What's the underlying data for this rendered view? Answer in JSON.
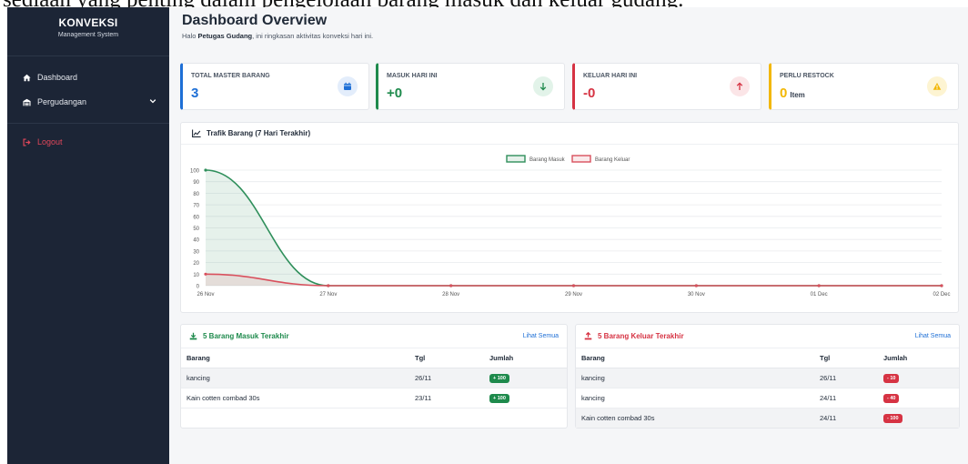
{
  "caption": "sediaan yang penting dalam pengelolaan barang masuk dan keluar gudang.",
  "sidebar": {
    "brand_title": "KONVEKSI",
    "brand_subtitle": "Management System",
    "items": [
      {
        "label": "Dashboard",
        "icon": "home-icon"
      },
      {
        "label": "Pergudangan",
        "icon": "warehouse-icon",
        "expandable": true
      }
    ],
    "logout_label": "Logout"
  },
  "header": {
    "title": "Dashboard Overview",
    "subtitle_prefix": "Halo ",
    "subtitle_user": "Petugas Gudang",
    "subtitle_suffix": ", ini ringkasan aktivitas konveksi hari ini."
  },
  "stats": [
    {
      "label": "TOTAL MASTER BARANG",
      "value": "3",
      "unit": "",
      "color": "#1e6fd6",
      "icon": "calendar-icon"
    },
    {
      "label": "MASUK HARI INI",
      "value": "+0",
      "unit": "",
      "color": "#1e8a4c",
      "icon": "arrow-down-icon"
    },
    {
      "label": "KELUAR HARI INI",
      "value": "-0",
      "unit": "",
      "color": "#d63343",
      "icon": "arrow-up-icon"
    },
    {
      "label": "PERLU RESTOCK",
      "value": "0",
      "unit": "Item",
      "color": "#f2b705",
      "icon": "warning-icon"
    }
  ],
  "chart_data": {
    "type": "line",
    "title": "Trafik Barang (7 Hari Terakhir)",
    "categories": [
      "26 Nov",
      "27 Nov",
      "28 Nov",
      "29 Nov",
      "30 Nov",
      "01 Dec",
      "02 Dec"
    ],
    "series": [
      {
        "name": "Barang Masuk",
        "values": [
          100,
          0,
          0,
          0,
          0,
          0,
          0
        ],
        "color": "#2f8f5b"
      },
      {
        "name": "Barang Keluar",
        "values": [
          10,
          0,
          0,
          0,
          0,
          0,
          0
        ],
        "color": "#d9505d"
      }
    ],
    "ylim": [
      0,
      100
    ],
    "yticks": [
      "0",
      "10",
      "20",
      "30",
      "40",
      "50",
      "60",
      "70",
      "80",
      "90",
      "100"
    ],
    "legend_position": "top-center",
    "grid": true
  },
  "masuk": {
    "title": "5 Barang Masuk Terakhir",
    "link": "Lihat Semua",
    "columns": [
      "Barang",
      "Tgl",
      "Jumlah"
    ],
    "rows": [
      {
        "barang": "kancing",
        "tgl": "26/11",
        "jumlah": "+ 100"
      },
      {
        "barang": "Kain cotten combad 30s",
        "tgl": "23/11",
        "jumlah": "+ 100"
      }
    ]
  },
  "keluar": {
    "title": "5 Barang Keluar Terakhir",
    "link": "Lihat Semua",
    "columns": [
      "Barang",
      "Tgl",
      "Jumlah"
    ],
    "rows": [
      {
        "barang": "kancing",
        "tgl": "26/11",
        "jumlah": "- 10"
      },
      {
        "barang": "kancing",
        "tgl": "24/11",
        "jumlah": "- 40"
      },
      {
        "barang": "Kain cotten combad 30s",
        "tgl": "24/11",
        "jumlah": "- 100"
      }
    ]
  }
}
